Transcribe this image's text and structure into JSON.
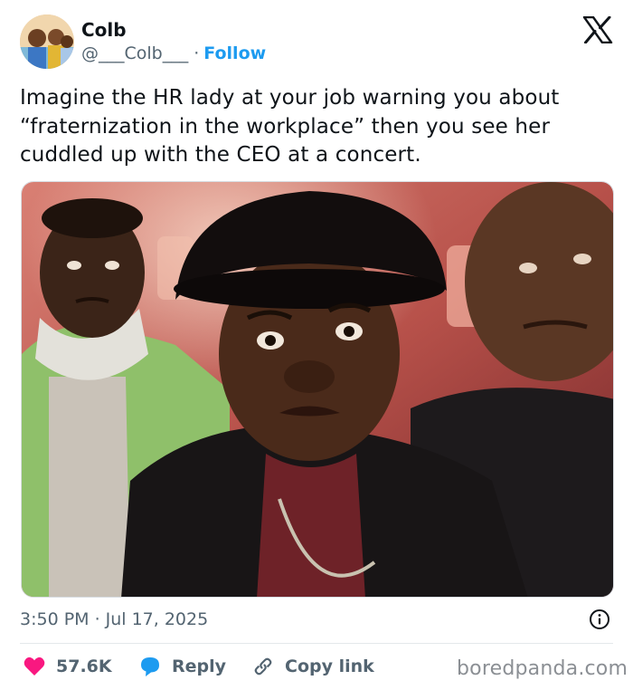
{
  "author": {
    "name": "Colb",
    "handle": "@___Colb___",
    "separator": "·",
    "follow_label": "Follow"
  },
  "tweet": {
    "text": "Imagine the HR lady at your job warning you about “fraternization in the workplace” then you see her cuddled up with the CEO at a concert."
  },
  "meta": {
    "time": "3:50 PM",
    "separator": "·",
    "date": "Jul 17, 2025"
  },
  "actions": {
    "likes": "57.6K",
    "reply_label": "Reply",
    "copy_link_label": "Copy link"
  },
  "watermark": "boredpanda.com",
  "icons": {
    "brand": "x-logo-icon",
    "like": "heart-icon",
    "reply": "speech-bubble-icon",
    "copy": "link-icon",
    "info": "info-icon"
  },
  "colors": {
    "text": "#0f1419",
    "secondary": "#536471",
    "follow": "#1d9bf0",
    "heart": "#f91880",
    "reply_bubble": "#1d9bf0"
  }
}
